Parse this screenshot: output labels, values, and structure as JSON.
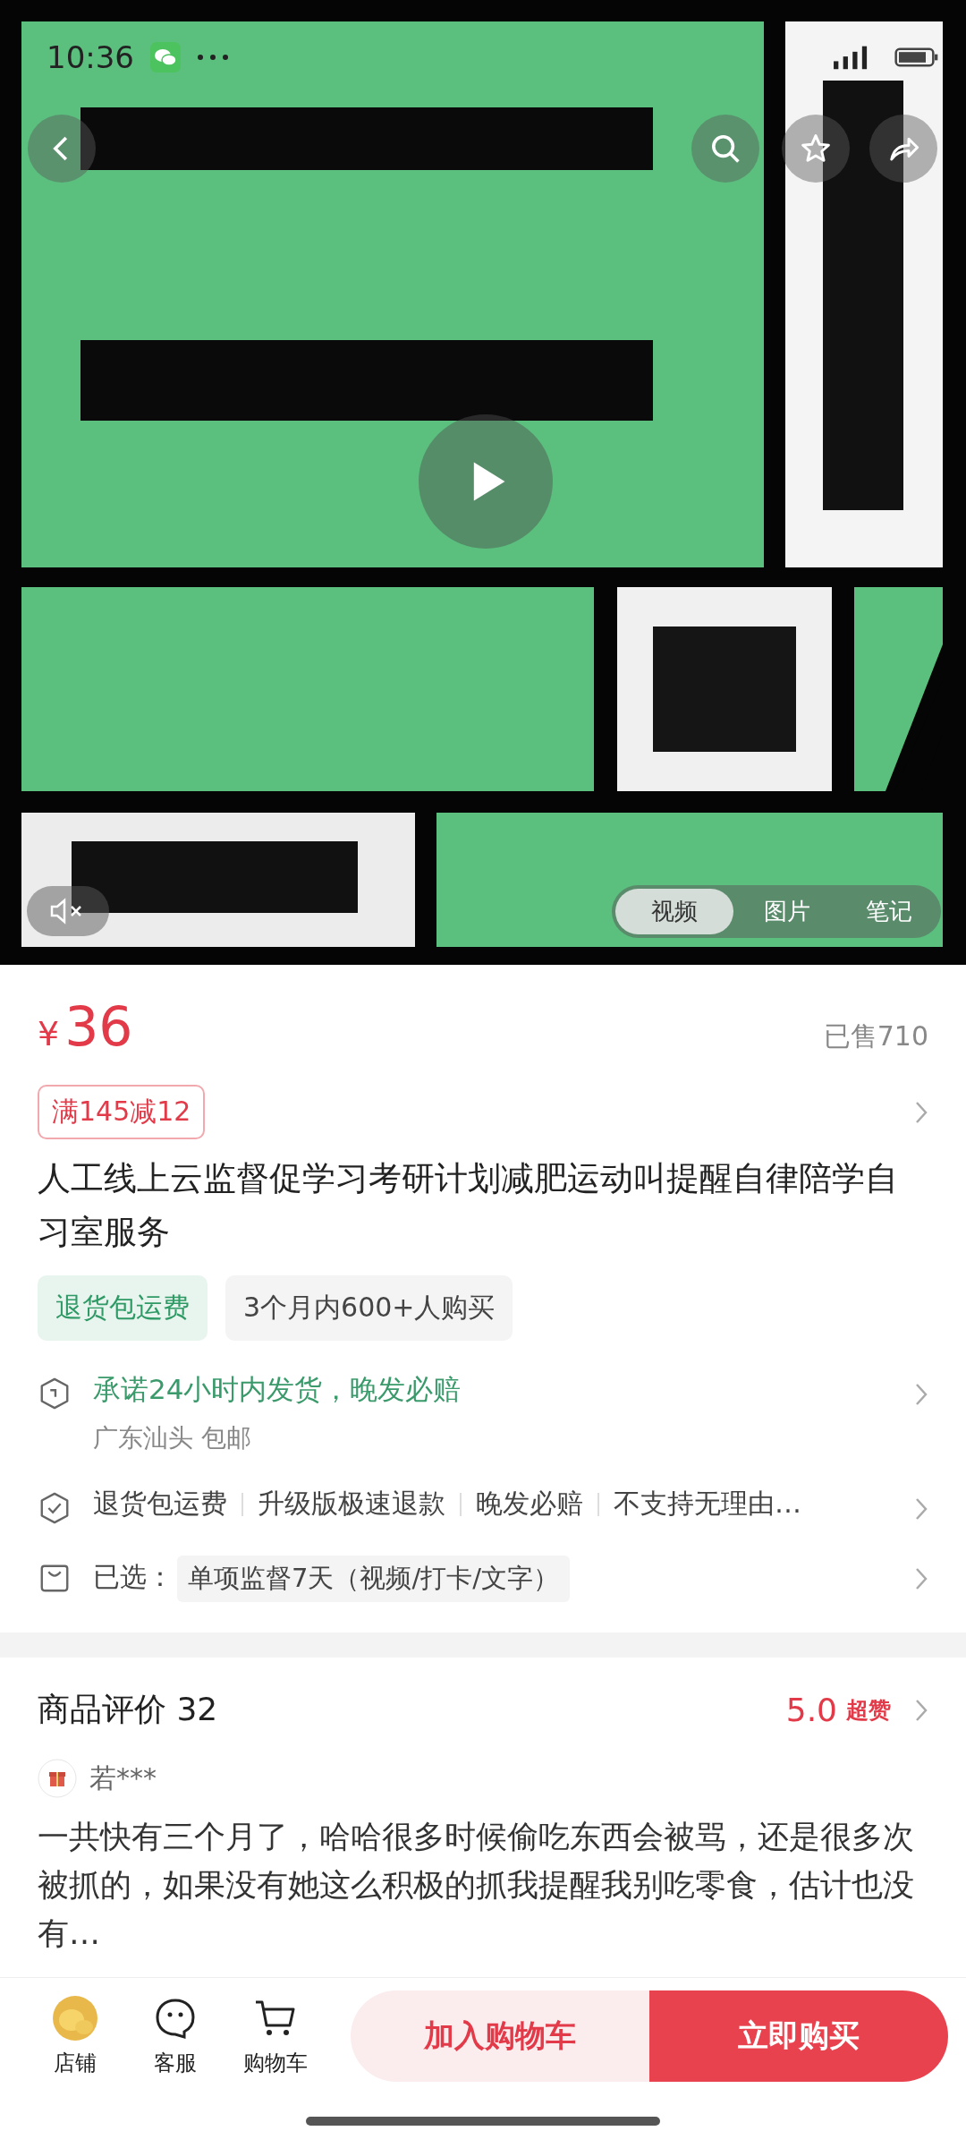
{
  "status_bar": {
    "time": "10:36"
  },
  "media": {
    "muted": true,
    "tabs": [
      {
        "label": "视频",
        "selected": true
      },
      {
        "label": "图片",
        "selected": false
      },
      {
        "label": "笔记",
        "selected": false
      }
    ]
  },
  "price": {
    "currency": "¥",
    "amount": "36",
    "sold": "已售710"
  },
  "coupon": "满145减12",
  "title": "人工线上云监督促学习考研计划减肥运动叫提醒自律陪学自习室服务",
  "tags": [
    {
      "label": "退货包运费",
      "kind": "highlight"
    },
    {
      "label": "3个月内600+人购买",
      "kind": "plain"
    }
  ],
  "shipping": {
    "promise": "承诺24小时内发货，晚发必赔",
    "origin": "广东汕头 包邮"
  },
  "services": [
    "退货包运费",
    "升级版极速退款",
    "晚发必赔",
    "不支持无理由…"
  ],
  "selection": {
    "label": "已选：",
    "value": "单项监督7天（视频/打卡/文字）"
  },
  "reviews": {
    "title": "商品评价 32",
    "score": "5.0",
    "score_label": "超赞",
    "items": [
      {
        "user": "若***",
        "text": "一共快有三个月了，哈哈很多时候偷吃东西会被骂，还是很多次被抓的，如果没有她这么积极的抓我提醒我别吃零食，估计也没有…"
      }
    ]
  },
  "bottom_bar": {
    "actions": [
      {
        "label": "店铺",
        "kind": "shop"
      },
      {
        "label": "客服",
        "kind": "service"
      },
      {
        "label": "购物车",
        "kind": "cart"
      }
    ],
    "add_to_cart": "加入购物车",
    "buy_now": "立即购买"
  }
}
